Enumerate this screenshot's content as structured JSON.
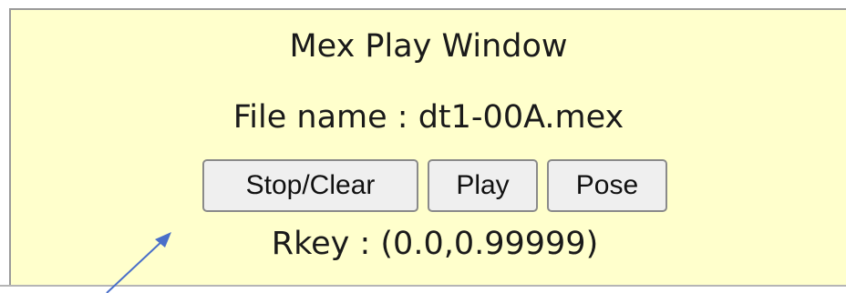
{
  "window": {
    "title": "Mex Play Window",
    "file_line": "File name : dt1-00A.mex",
    "rkey_line": "Rkey : (0.0,0.99999)",
    "background_color": "#ffffcc"
  },
  "buttons": {
    "stop_clear": "Stop/Clear",
    "play": "Play",
    "pose": "Pose"
  },
  "annotation": {
    "arrow_color": "#4a6fc9",
    "arrow_icon": "annotation-arrow-icon"
  }
}
